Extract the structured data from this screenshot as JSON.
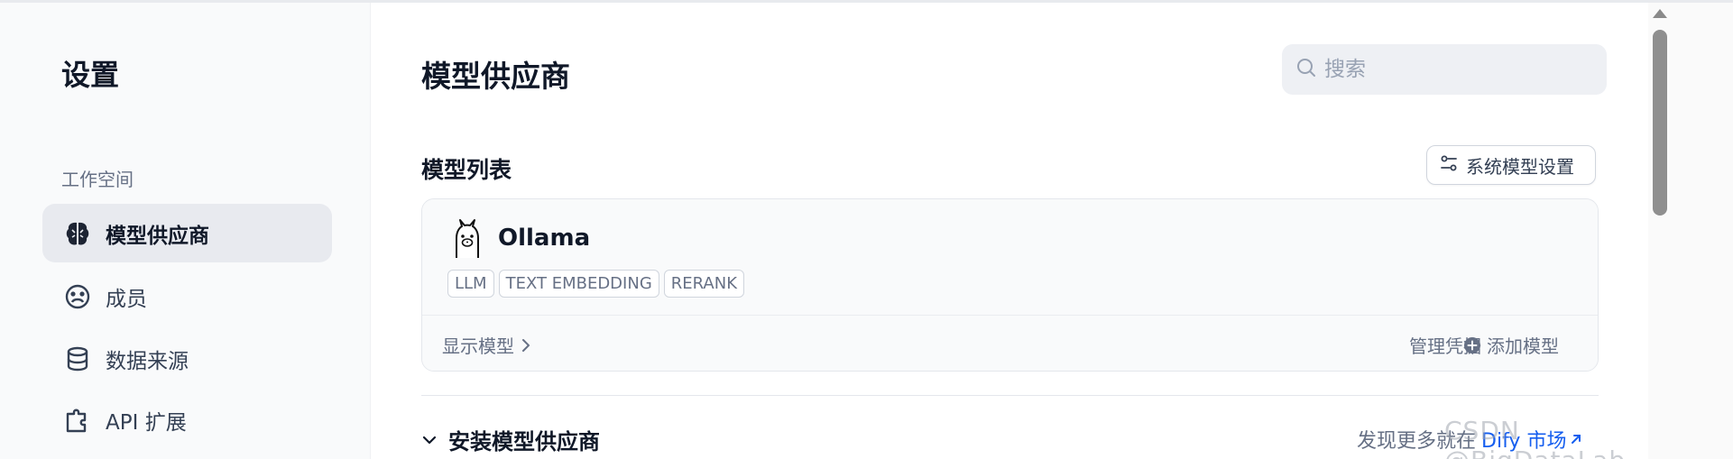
{
  "sidebar": {
    "title": "设置",
    "section_label": "工作空间",
    "items": [
      {
        "label": "模型供应商",
        "icon": "brain-icon",
        "active": true
      },
      {
        "label": "成员",
        "icon": "members-icon",
        "active": false
      },
      {
        "label": "数据来源",
        "icon": "database-icon",
        "active": false
      },
      {
        "label": "API 扩展",
        "icon": "puzzle-icon",
        "active": false
      }
    ]
  },
  "main": {
    "title": "模型供应商",
    "search": {
      "placeholder": "搜索",
      "value": ""
    },
    "model_list_title": "模型列表",
    "system_settings_label": "系统模型设置",
    "provider": {
      "name": "Ollama",
      "tags": [
        "LLM",
        "TEXT EMBEDDING",
        "RERANK"
      ],
      "show_models_label": "显示模型",
      "manage_credentials_label": "管理凭据",
      "add_model_label": "添加模型"
    },
    "install_title": "安装模型供应商",
    "discover_text": "发现更多就在",
    "discover_link": "Dify 市场",
    "watermark": "CSDN @BigDataLab"
  },
  "colors": {
    "accent_link": "#155eef",
    "active_bg": "#e8eaef",
    "text_primary": "#101828",
    "text_secondary": "#667085"
  }
}
